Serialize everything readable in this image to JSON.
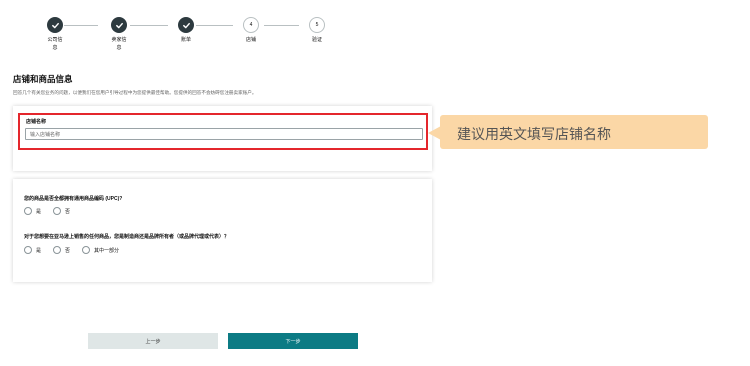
{
  "stepper": {
    "steps": [
      {
        "label_line1": "公司信",
        "label_line2": "息",
        "state": "done",
        "number": ""
      },
      {
        "label_line1": "卖家信",
        "label_line2": "息",
        "state": "done",
        "number": ""
      },
      {
        "label_line1": "账单",
        "label_line2": "",
        "state": "done",
        "number": ""
      },
      {
        "label_line1": "店铺",
        "label_line2": "",
        "state": "todo",
        "number": "4"
      },
      {
        "label_line1": "验证",
        "label_line2": "",
        "state": "todo",
        "number": "5"
      }
    ]
  },
  "page": {
    "title": "店铺和商品信息",
    "description": "回答几个有关您业务的问题，以便我们在您用户引导过程中为您提供最佳帮助。您提供的回答不会妨碍您注册卖家账户。"
  },
  "store": {
    "label": "店铺名称",
    "placeholder": "输入店铺名称",
    "value": ""
  },
  "questions": [
    {
      "title": "您的商品是否全都拥有通用商品编码 (UPC)?",
      "options": [
        "是",
        "否"
      ]
    },
    {
      "title": "对于您想要在亚马逊上销售的任何商品，您是制造商还是品牌所有者（或品牌代理或代表）？",
      "options": [
        "是",
        "否",
        "其中一部分"
      ]
    }
  ],
  "tooltip": {
    "text": "建议用英文填写店铺名称"
  },
  "buttons": {
    "prev": "上一步",
    "next": "下一步"
  },
  "colors": {
    "accent": "#0c7b84",
    "step_done": "#2d3a3f",
    "highlight": "#e4262c",
    "tooltip_bg": "#fbd7a6"
  }
}
